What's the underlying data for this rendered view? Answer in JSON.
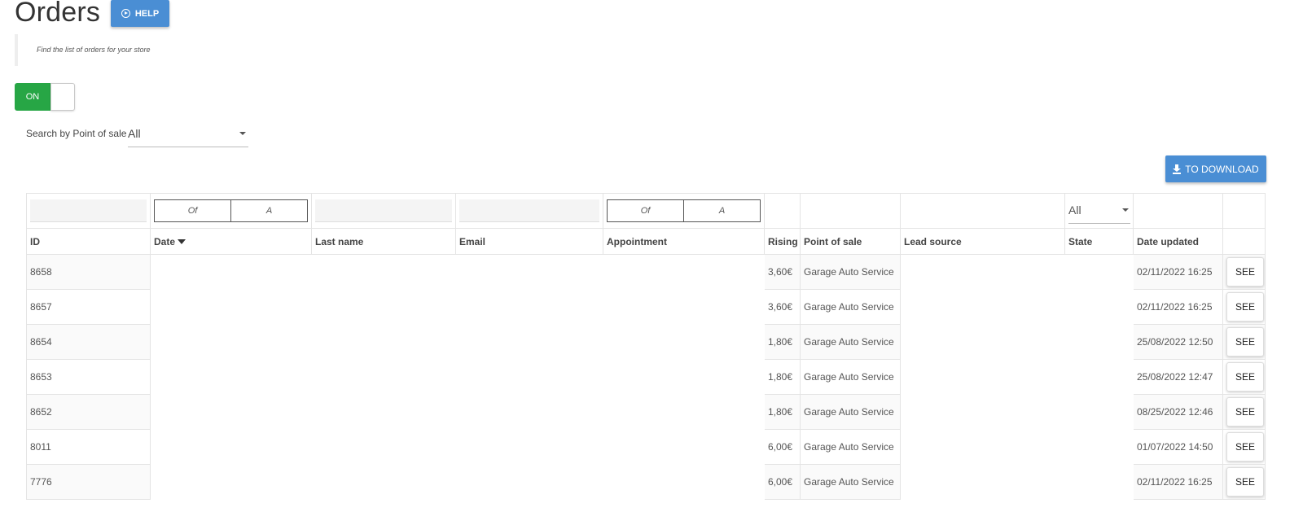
{
  "header": {
    "title": "Orders",
    "help_label": "HELP",
    "subtitle": "Find the list of orders for your store"
  },
  "toggle": {
    "label": "ON"
  },
  "pos_filter": {
    "label": "Search by Point of sale",
    "value": "All"
  },
  "download_label": "TO DOWNLOAD",
  "filters": {
    "date_from": "Of",
    "date_to": "A",
    "appt_from": "Of",
    "appt_to": "A",
    "state": "All"
  },
  "columns": [
    "ID",
    "Date",
    "Last name",
    "Email",
    "Appointment",
    "Rising",
    "Point of sale",
    "Lead source",
    "State",
    "Date updated",
    ""
  ],
  "rows": [
    {
      "id": "8658",
      "rising": "3,60€",
      "pos": "Garage Auto Service",
      "updated": "02/11/2022 16:25",
      "action": "SEE"
    },
    {
      "id": "8657",
      "rising": "3,60€",
      "pos": "Garage Auto Service",
      "updated": "02/11/2022 16:25",
      "action": "SEE"
    },
    {
      "id": "8654",
      "rising": "1,80€",
      "pos": "Garage Auto Service",
      "updated": "25/08/2022 12:50",
      "action": "SEE"
    },
    {
      "id": "8653",
      "rising": "1,80€",
      "pos": "Garage Auto Service",
      "updated": "25/08/2022 12:47",
      "action": "SEE"
    },
    {
      "id": "8652",
      "rising": "1,80€",
      "pos": "Garage Auto Service",
      "updated": "08/25/2022 12:46",
      "action": "SEE"
    },
    {
      "id": "8011",
      "rising": "6,00€",
      "pos": "Garage Auto Service",
      "updated": "01/07/2022 14:50",
      "action": "SEE"
    },
    {
      "id": "7776",
      "rising": "6,00€",
      "pos": "Garage Auto Service",
      "updated": "02/11/2022 16:25",
      "action": "SEE"
    }
  ],
  "colors": {
    "primary": "#4a8ed4",
    "toggle_on": "#27a645"
  }
}
